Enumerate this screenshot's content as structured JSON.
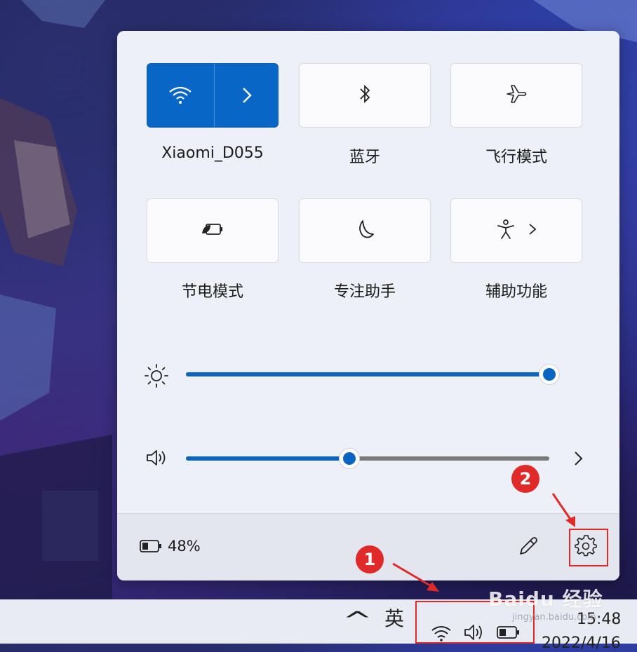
{
  "quick_settings": {
    "tiles": [
      {
        "label": "Xiaomi_D055",
        "icon": "wifi-icon",
        "active": true
      },
      {
        "label": "蓝牙",
        "icon": "bluetooth-icon",
        "active": false
      },
      {
        "label": "飞行模式",
        "icon": "airplane-icon",
        "active": false
      },
      {
        "label": "节电模式",
        "icon": "battery-saver-icon",
        "active": false
      },
      {
        "label": "专注助手",
        "icon": "moon-icon",
        "active": false
      },
      {
        "label": "辅助功能",
        "icon": "accessibility-icon",
        "active": false
      }
    ],
    "brightness": {
      "icon": "brightness-icon",
      "level": 1.0
    },
    "volume": {
      "icon": "speaker-icon",
      "level": 0.45
    },
    "battery": {
      "icon": "battery-icon",
      "percent": "48%"
    },
    "accent_color": "#0867c6"
  },
  "taskbar": {
    "chevron": "^",
    "ime": "英",
    "time": "15:48",
    "date": "2022/4/16"
  },
  "annotations": {
    "badge1": "1",
    "badge2": "2",
    "color": "#e02a2a"
  },
  "watermark": {
    "brand": "Baidu 经验",
    "url": "jingyan.baidu.com"
  }
}
